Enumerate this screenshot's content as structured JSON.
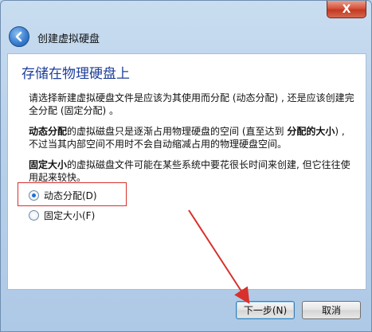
{
  "window": {
    "title": "创建虚拟硬盘",
    "close_label": "X"
  },
  "main": {
    "heading": "存储在物理硬盘上",
    "para1": "请选择新建虚拟硬盘文件是应该为其使用而分配 (动态分配) , 还是应该创建完全分配 (固定分配) 。",
    "para2_bold1": "动态分配",
    "para2_mid": "的虚拟磁盘只是逐渐占用物理硬盘的空间 (直至达到 ",
    "para2_bold2": "分配的大小",
    "para2_end": ") , 不过当其内部空间不用时不会自动缩减占用的物理硬盘空间。",
    "para3_bold": "固定大小",
    "para3_rest": "的虚拟磁盘文件可能在某些系统中要花很长时间来创建, 但它往往使用起来较快。",
    "options": [
      {
        "label": "动态分配(D)",
        "checked": true
      },
      {
        "label": "固定大小(F)",
        "checked": false
      }
    ]
  },
  "footer": {
    "next_label": "下一步(N)",
    "cancel_label": "取消"
  }
}
